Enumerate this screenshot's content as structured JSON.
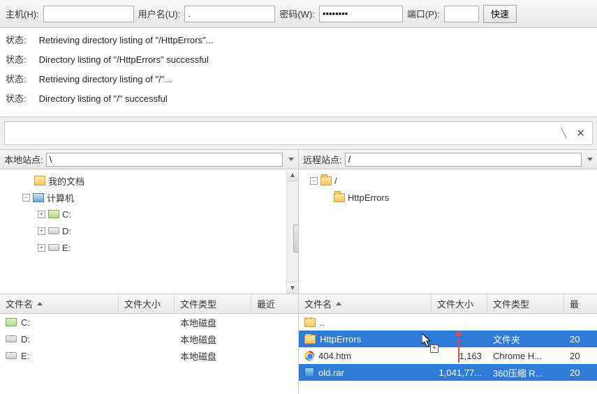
{
  "conn": {
    "host_label": "主机(H):",
    "host_value": "",
    "user_label": "用户名(U):",
    "user_value": ".",
    "pass_label": "密码(W):",
    "pass_value": "••••••••",
    "port_label": "端口(P):",
    "port_value": "",
    "quick_button": "快速"
  },
  "log": [
    {
      "label": "状态:",
      "msg": "Retrieving directory listing of \"/HttpErrors\"..."
    },
    {
      "label": "状态:",
      "msg": "Directory listing of \"/HttpErrors\" successful"
    },
    {
      "label": "状态:",
      "msg": "Retrieving directory listing of \"/\"..."
    },
    {
      "label": "状态:",
      "msg": "Directory listing of \"/\" successful"
    }
  ],
  "cmd": {
    "value": "",
    "close_glyph": "✕",
    "caret_glyph": "╲"
  },
  "local": {
    "site_label": "本地站点:",
    "path": "\\",
    "tree": {
      "mydocs": "我的文档",
      "computer": "计算机",
      "drive_c": "C:",
      "drive_d": "D:",
      "drive_e": "E:"
    },
    "cols": {
      "name": "文件名",
      "size": "文件大小",
      "type": "文件类型",
      "modified": "最近"
    },
    "rows": [
      {
        "name": "C:",
        "size": "",
        "type": "本地磁盘",
        "icon": "local"
      },
      {
        "name": "D:",
        "size": "",
        "type": "本地磁盘",
        "icon": "drive"
      },
      {
        "name": "E:",
        "size": "",
        "type": "本地磁盘",
        "icon": "drive"
      }
    ]
  },
  "remote": {
    "site_label": "远程站点:",
    "path": "/",
    "tree": {
      "root": "/",
      "httperrors": "HttpErrors"
    },
    "cols": {
      "name": "文件名",
      "size": "文件大小",
      "type": "文件类型",
      "modified": "最"
    },
    "rows": [
      {
        "name": "..",
        "size": "",
        "type": "",
        "mod": "",
        "icon": "folder",
        "sel": false
      },
      {
        "name": "HttpErrors",
        "size": "",
        "type": "文件夹",
        "mod": "20",
        "icon": "folder",
        "sel": true
      },
      {
        "name": "404.htm",
        "size": "1,163",
        "type": "Chrome H...",
        "mod": "20",
        "icon": "chrome",
        "sel": false
      },
      {
        "name": "old.rar",
        "size": "1,041,77...",
        "type": "360压缩 R...",
        "mod": "20",
        "icon": "rar",
        "sel": true
      }
    ]
  },
  "expanders": {
    "plus": "+",
    "minus": "−"
  }
}
